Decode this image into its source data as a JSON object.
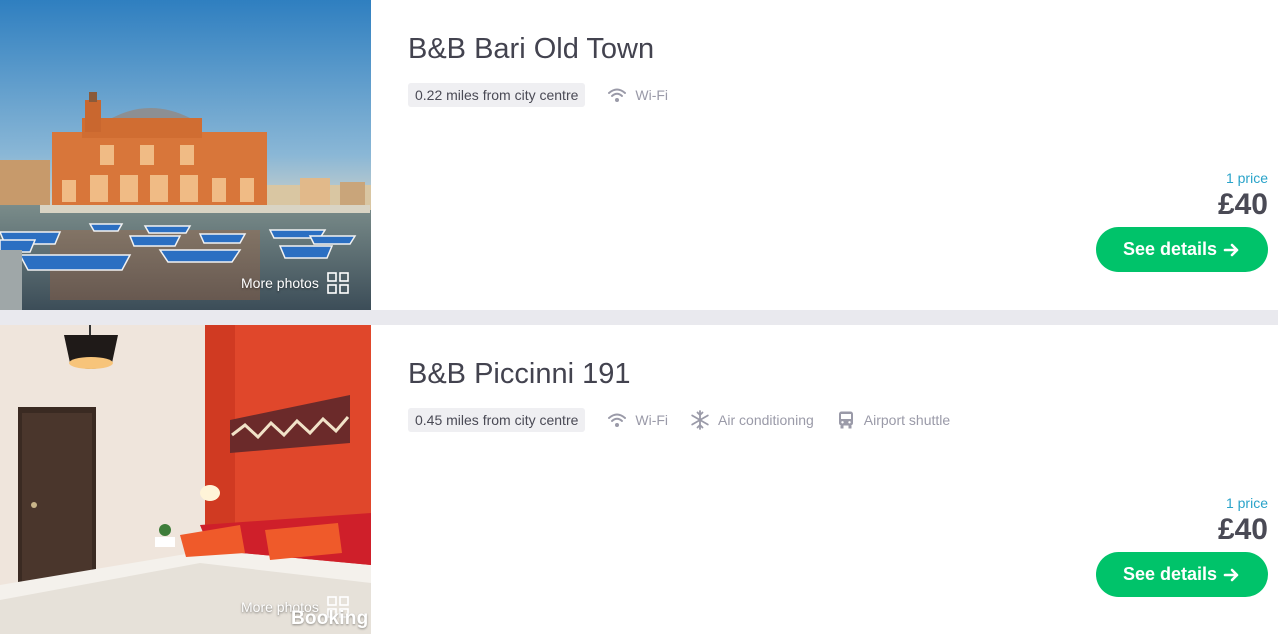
{
  "listings": [
    {
      "title": "B&B Bari Old Town",
      "distance": "0.22 miles from city centre",
      "amenities": [
        {
          "icon": "wifi-icon",
          "label": "Wi-Fi"
        }
      ],
      "photos_link": "More photos",
      "price_count": "1 price",
      "price": "£40",
      "cta": "See details"
    },
    {
      "title": "B&B Piccinni 191",
      "distance": "0.45 miles from city centre",
      "amenities": [
        {
          "icon": "wifi-icon",
          "label": "Wi-Fi"
        },
        {
          "icon": "snowflake-icon",
          "label": "Air conditioning"
        },
        {
          "icon": "bus-icon",
          "label": "Airport shuttle"
        }
      ],
      "photos_link": "More photos",
      "photo_watermark": "Booking",
      "price_count": "1 price",
      "price": "£40",
      "cta": "See details"
    }
  ],
  "colors": {
    "cta": "#00c36a",
    "price_count": "#29a3c9",
    "text": "#4a4a55",
    "amenity": "#9a9aa8"
  }
}
